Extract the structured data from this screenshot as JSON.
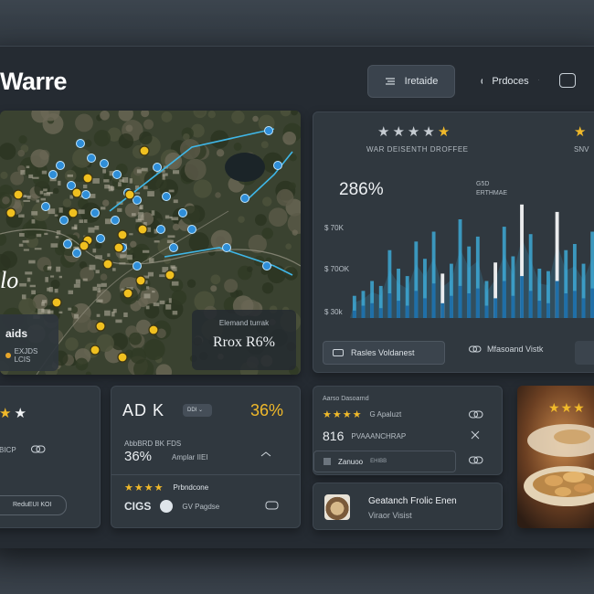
{
  "app": {
    "title": "Warre"
  },
  "toolbar": {
    "btn_a_label": "Iretaide",
    "btn_b_label": "Prdoces",
    "icons": [
      "menu-icon",
      "link-icon",
      "chevron-down-icon",
      "window-icon"
    ]
  },
  "map_panel": {
    "left_label": {
      "title": "aids",
      "sub": "EXJDS LCIS"
    },
    "right_label": {
      "sub": "Elemand turrak",
      "value": "Rrox R6%"
    },
    "hand_text": "lo"
  },
  "chart_panel": {
    "stars_rating": 4,
    "subtitle": "WAR DEISENTH DROFFEE",
    "subtitle_right": "SNV",
    "headline": "286%",
    "legend": [
      "G5D",
      "ERTHMAE"
    ],
    "button_label": "Rasles Voldanest",
    "link_label": "Mfasoand Vistk",
    "y_ticks": [
      "$ 70K",
      "$ 70OK",
      "$ 30k"
    ]
  },
  "chart_data": {
    "type": "bar",
    "title": "",
    "xlabel": "",
    "ylabel": "",
    "x_tick_labels": [
      "",
      "",
      "",
      "",
      "",
      "",
      "",
      "",
      ""
    ],
    "series": [
      {
        "values": [
          18,
          22,
          30,
          26,
          55,
          40,
          34,
          62,
          48,
          70,
          36,
          44,
          80,
          58,
          66,
          30,
          45,
          74,
          50,
          92,
          68,
          40,
          38,
          86,
          55,
          60,
          44,
          70
        ]
      },
      {
        "values": [
          6,
          10,
          12,
          8,
          20,
          14,
          10,
          22,
          16,
          28,
          12,
          18,
          26,
          20,
          24,
          10,
          16,
          30,
          18,
          34,
          22,
          14,
          12,
          30,
          20,
          22,
          16,
          24
        ]
      }
    ],
    "accent_color": "#3fb7e8",
    "highlight_color": "#ffffff"
  },
  "panel_left": {
    "stars": 2,
    "caption": "BICP",
    "button": "ReduEUI KOI"
  },
  "panel_mid": {
    "title": "AD K",
    "chip": "DDI",
    "percent": "36%",
    "row1": "AbbBRD BK FDS",
    "row2_value": "36%",
    "row2_label": "Amplar IIEI",
    "stars": 4,
    "stars_label": "Prbndcone",
    "footer_logo": "CIGS",
    "footer_label": "GV Pagdse"
  },
  "panel_rt": {
    "header": "Aarso Dasoarnd",
    "stars": 4,
    "stars_label": "G Apaluzt",
    "value": "816",
    "value_label": "PVAAANCHRAP",
    "row_label": "Zanuoo",
    "row_sub": "EHIBB"
  },
  "panel_rb": {
    "title": "Geatanch Frolic Enen",
    "sub": "Viraor Visist"
  },
  "food": {
    "stars": 3
  },
  "colors": {
    "accent": "#3fb7e8",
    "gold": "#f0b92a",
    "panel": "#30383f",
    "bg": "#252b32"
  }
}
